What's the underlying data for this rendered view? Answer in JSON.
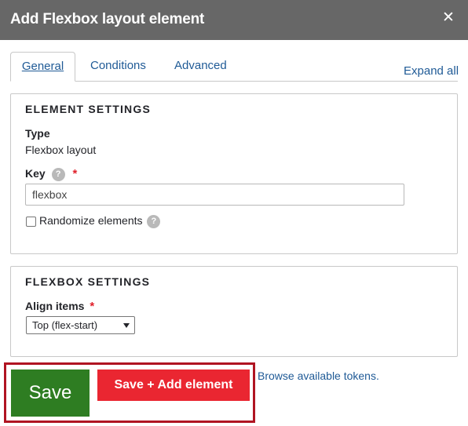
{
  "dialog": {
    "title": "Add Flexbox layout element",
    "close_glyph": "✕"
  },
  "tabs": [
    {
      "label": "General",
      "active": true
    },
    {
      "label": "Conditions",
      "active": false
    },
    {
      "label": "Advanced",
      "active": false
    }
  ],
  "expand_all_label": "Expand all",
  "element_settings": {
    "legend": "ELEMENT SETTINGS",
    "type_label": "Type",
    "type_value": "Flexbox layout",
    "key_label": "Key",
    "key_value": "flexbox",
    "randomize_label": "Randomize elements",
    "randomize_checked": false,
    "help_glyph": "?",
    "required_glyph": "*"
  },
  "flexbox_settings": {
    "legend": "FLEXBOX SETTINGS",
    "align_label": "Align items",
    "align_value": "Top (flex-start)",
    "required_glyph": "*"
  },
  "actions": {
    "save_label": "Save",
    "save_add_label": "Save + Add element",
    "tokens_link": "Browse available tokens."
  },
  "colors": {
    "titlebar": "#676767",
    "link": "#1f5a96",
    "save": "#2e7d22",
    "save_add": "#ea2631",
    "highlight": "#b01422",
    "required": "#e0202a"
  },
  "icons": {
    "close": "close-icon",
    "help": "help-icon",
    "dropdown": "chevron-down-icon"
  }
}
